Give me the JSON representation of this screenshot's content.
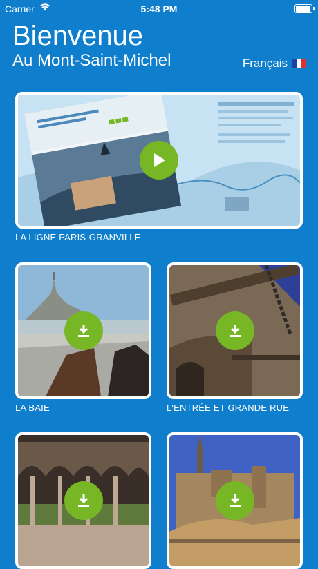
{
  "status": {
    "carrier": "Carrier",
    "time": "5:48 PM"
  },
  "header": {
    "title": "Bienvenue",
    "subtitle": "Au Mont-Saint-Michel",
    "language": "Français"
  },
  "featured": {
    "label": "LA LIGNE PARIS-GRANVILLE"
  },
  "grid": [
    {
      "label": "LA BAIE"
    },
    {
      "label": "L'ENTRÉE ET GRANDE RUE"
    },
    {
      "label": ""
    },
    {
      "label": ""
    }
  ],
  "colors": {
    "background": "#0f7fcd",
    "accent": "#77b725"
  }
}
